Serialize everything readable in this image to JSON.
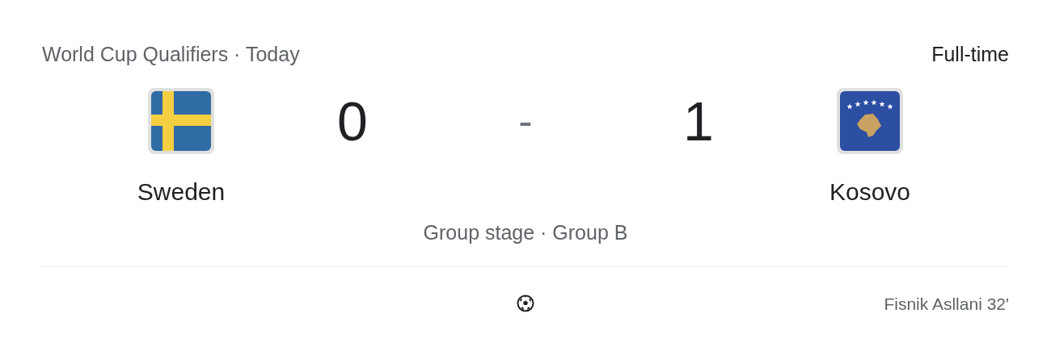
{
  "header": {
    "competition": "World Cup Qualifiers · Today",
    "status": "Full-time"
  },
  "home": {
    "name": "Sweden",
    "flag": {
      "kind": "sweden"
    },
    "score": "0"
  },
  "separator": "-",
  "away": {
    "name": "Kosovo",
    "flag": {
      "kind": "kosovo"
    },
    "score": "1"
  },
  "stage": "Group stage · Group B",
  "goals": [
    {
      "kind": "away",
      "scorer": "Fisnik Asllani 32'"
    }
  ]
}
